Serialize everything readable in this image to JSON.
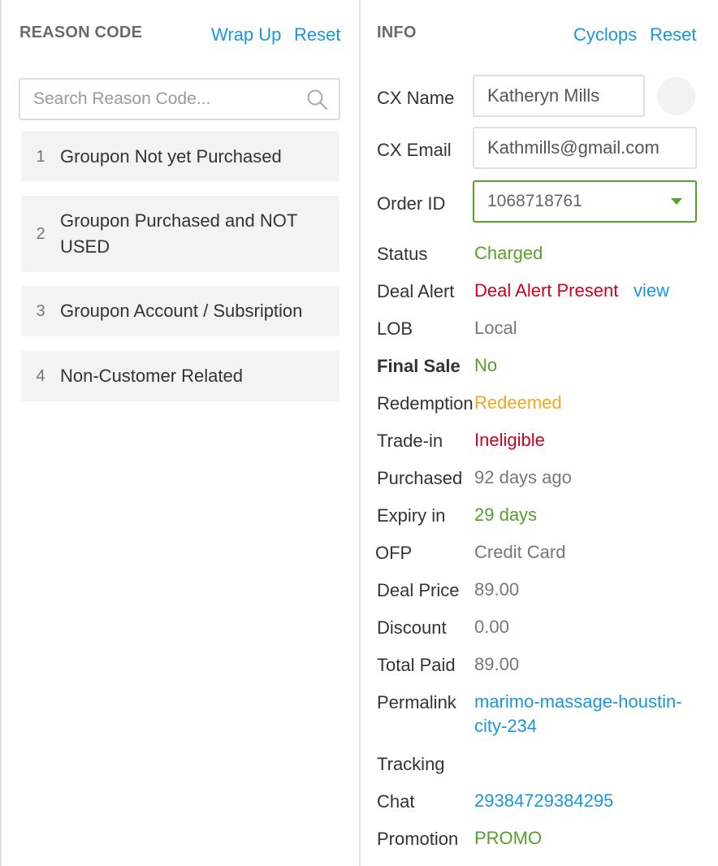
{
  "reason_panel": {
    "title": "REASON CODE",
    "wrap_up_label": "Wrap Up",
    "reset_label": "Reset",
    "search_placeholder": "Search Reason Code...",
    "items": [
      {
        "num": "1",
        "label": "Groupon Not yet Purchased"
      },
      {
        "num": "2",
        "label": "Groupon Purchased and NOT USED"
      },
      {
        "num": "3",
        "label": "Groupon Account / Subsription"
      },
      {
        "num": "4",
        "label": "Non-Customer Related"
      }
    ]
  },
  "info_panel": {
    "title": "INFO",
    "cyclops_label": "Cyclops",
    "reset_label": "Reset",
    "cx_name_label": "CX Name",
    "cx_name_value": "Katheryn Mills",
    "cx_email_label": "CX Email",
    "cx_email_value": "Kathmills@gmail.com",
    "order_id_label": "Order ID",
    "order_id_value": "1068718761",
    "status_label": "Status",
    "status_value": "Charged",
    "deal_alert_label": "Deal Alert",
    "deal_alert_value": "Deal Alert Present",
    "deal_alert_link": "view",
    "lob_label": "LOB",
    "lob_value": "Local",
    "final_sale_label": "Final Sale",
    "final_sale_value": "No",
    "redemption_label": "Redemption",
    "redemption_value": "Redeemed",
    "trade_in_label": "Trade-in",
    "trade_in_value": "Ineligible",
    "purchased_label": "Purchased",
    "purchased_value": "92 days ago",
    "expiry_label": "Expiry in",
    "expiry_value": "29 days",
    "ofp_label": "OFP",
    "ofp_value": "Credit Card",
    "deal_price_label": "Deal Price",
    "deal_price_value": "89.00",
    "discount_label": "Discount",
    "discount_value": "0.00",
    "total_paid_label": "Total Paid",
    "total_paid_value": "89.00",
    "permalink_label": "Permalink",
    "permalink_line1": "marimo-massage-houstin-",
    "permalink_line2": "city-234",
    "tracking_label": "Tracking",
    "chat_label": "Chat",
    "chat_value": "29384729384295",
    "promotion_label": "Promotion",
    "promotion_value": "PROMO"
  },
  "colors": {
    "link": "#1a96dd",
    "green": "#56a02a",
    "red": "#d0021b",
    "orange": "#f5a623",
    "muted": "#777777"
  }
}
